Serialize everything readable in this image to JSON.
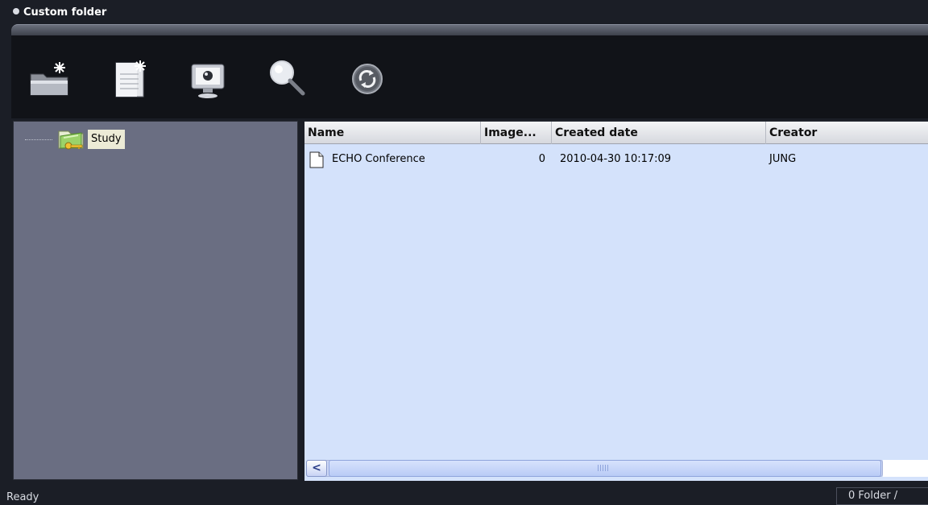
{
  "window": {
    "title": "Custom folder"
  },
  "toolbar": {
    "buttons": [
      {
        "icon": "new-folder-icon"
      },
      {
        "icon": "new-document-icon"
      },
      {
        "icon": "monitor-icon"
      },
      {
        "icon": "search-icon"
      },
      {
        "icon": "refresh-icon"
      }
    ]
  },
  "tree": {
    "root_label": "Study",
    "root_icon": "key-folder-icon"
  },
  "list": {
    "columns": [
      "Name",
      "Image...",
      "Created date",
      "Creator"
    ],
    "rows": [
      {
        "name": "ECHO Conference",
        "images": "0",
        "created": "2010-04-30 10:17:09",
        "creator": "JUNG",
        "icon": "document-icon"
      }
    ]
  },
  "scrollbar": {
    "left_arrow": "<"
  },
  "status": {
    "text": "Ready",
    "panel": "0 Folder /"
  },
  "colors": {
    "tree_bg": "#6a6e82",
    "list_bg": "#d4e2fb",
    "chrome_bg": "#1b1e26"
  }
}
